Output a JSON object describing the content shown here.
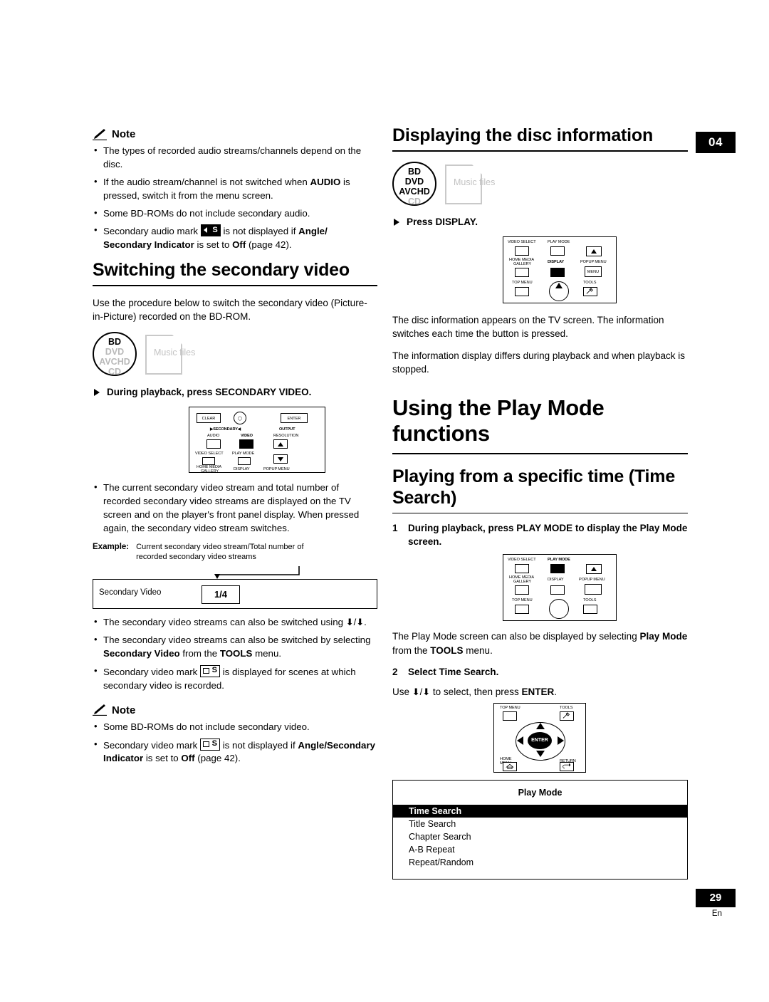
{
  "page": {
    "chapter_tab": "04",
    "page_number": "29",
    "lang": "En"
  },
  "left": {
    "note1": {
      "heading": "Note",
      "items": [
        "The types of recorded audio streams/channels depend on the disc.",
        "If the audio stream/channel is not switched when AUDIO is pressed, switch it from the menu screen.",
        "Some BD-ROMs do not include secondary audio.",
        "Secondary audio mark  is not displayed if Angle/Secondary Indicator is set to Off (page 42)."
      ]
    },
    "section_title": "Switching the secondary video",
    "intro": "Use the procedure below to switch the secondary video (Picture-in-Picture) recorded on the BD-ROM.",
    "disc_icons": {
      "oval": [
        "BD",
        "DVD",
        "AVCHD",
        "CD"
      ],
      "page_label": "Music files"
    },
    "step": "During playback, press SECONDARY VIDEO.",
    "remote_keys": {
      "clear": "CLEAR",
      "circle": "⭘",
      "enter": "ENTER",
      "secondary": "SECONDARY",
      "output": "OUTPUT",
      "audio": "AUDIO",
      "video": "VIDEO",
      "resolution": "RESOLUTION",
      "video_select": "VIDEO SELECT",
      "play_mode": "PLAY MODE",
      "home_media": "HOME MEDIA",
      "gallery": "GALLERY",
      "display": "DISPLAY",
      "popup_menu": "POPUP MENU"
    },
    "bullets2": [
      "The current secondary video stream and total number of recorded secondary video streams are displayed on the TV screen and on the player's front panel display. When pressed again, the secondary video stream switches."
    ],
    "example": {
      "label": "Example:",
      "caption": "Current secondary video stream/Total number of recorded secondary video streams",
      "bar_label": "Secondary Video",
      "bar_value": "1/4"
    },
    "bullets3": [
      "The secondary video streams can also be switched using ⬆/⬇.",
      "The secondary video streams can also be switched by selecting Secondary Video from the TOOLS menu.",
      "Secondary video mark  is displayed for scenes at which secondary video is recorded."
    ],
    "note2": {
      "heading": "Note",
      "items": [
        "Some BD-ROMs do not include secondary video.",
        "Secondary video mark  is not displayed if Angle/Secondary Indicator is set to Off (page 42)."
      ]
    }
  },
  "right": {
    "section_title": "Displaying the disc information",
    "disc_icons": {
      "oval": [
        "BD",
        "DVD",
        "AVCHD",
        "CD"
      ],
      "page_label": "Music files"
    },
    "step": "Press DISPLAY.",
    "remote_keys": {
      "video_select": "VIDEO SELECT",
      "play_mode": "PLAY MODE",
      "home_media": "HOME MEDIA",
      "gallery": "GALLERY",
      "display": "DISPLAY",
      "popup_menu": "POPUP MENU",
      "menu": "MENU",
      "top_menu": "TOP MENU",
      "tools": "TOOLS",
      "home_menu": "HOME MENU",
      "return": "RETURN",
      "enter": "ENTER"
    },
    "para1": "The disc information appears on the TV screen. The information switches each time the button is pressed.",
    "para2": "The information display differs during playback and when playback is stopped.",
    "big_title": "Using the Play Mode functions",
    "section_title2": "Playing from a specific time (Time Search)",
    "step1": {
      "num": "1",
      "text": "During playback, press PLAY MODE to display the Play Mode screen."
    },
    "para3": "The Play Mode screen can also be displayed by selecting Play Mode from the TOOLS menu.",
    "step2": {
      "num": "2",
      "text": "Select Time Search."
    },
    "para4": "Use ⬆/⬇ to select, then press ENTER.",
    "play_mode_screen": {
      "title": "Play Mode",
      "items": [
        "Time Search",
        "Title Search",
        "Chapter Search",
        "A-B Repeat",
        "Repeat/Random"
      ],
      "selected_index": 0
    }
  }
}
